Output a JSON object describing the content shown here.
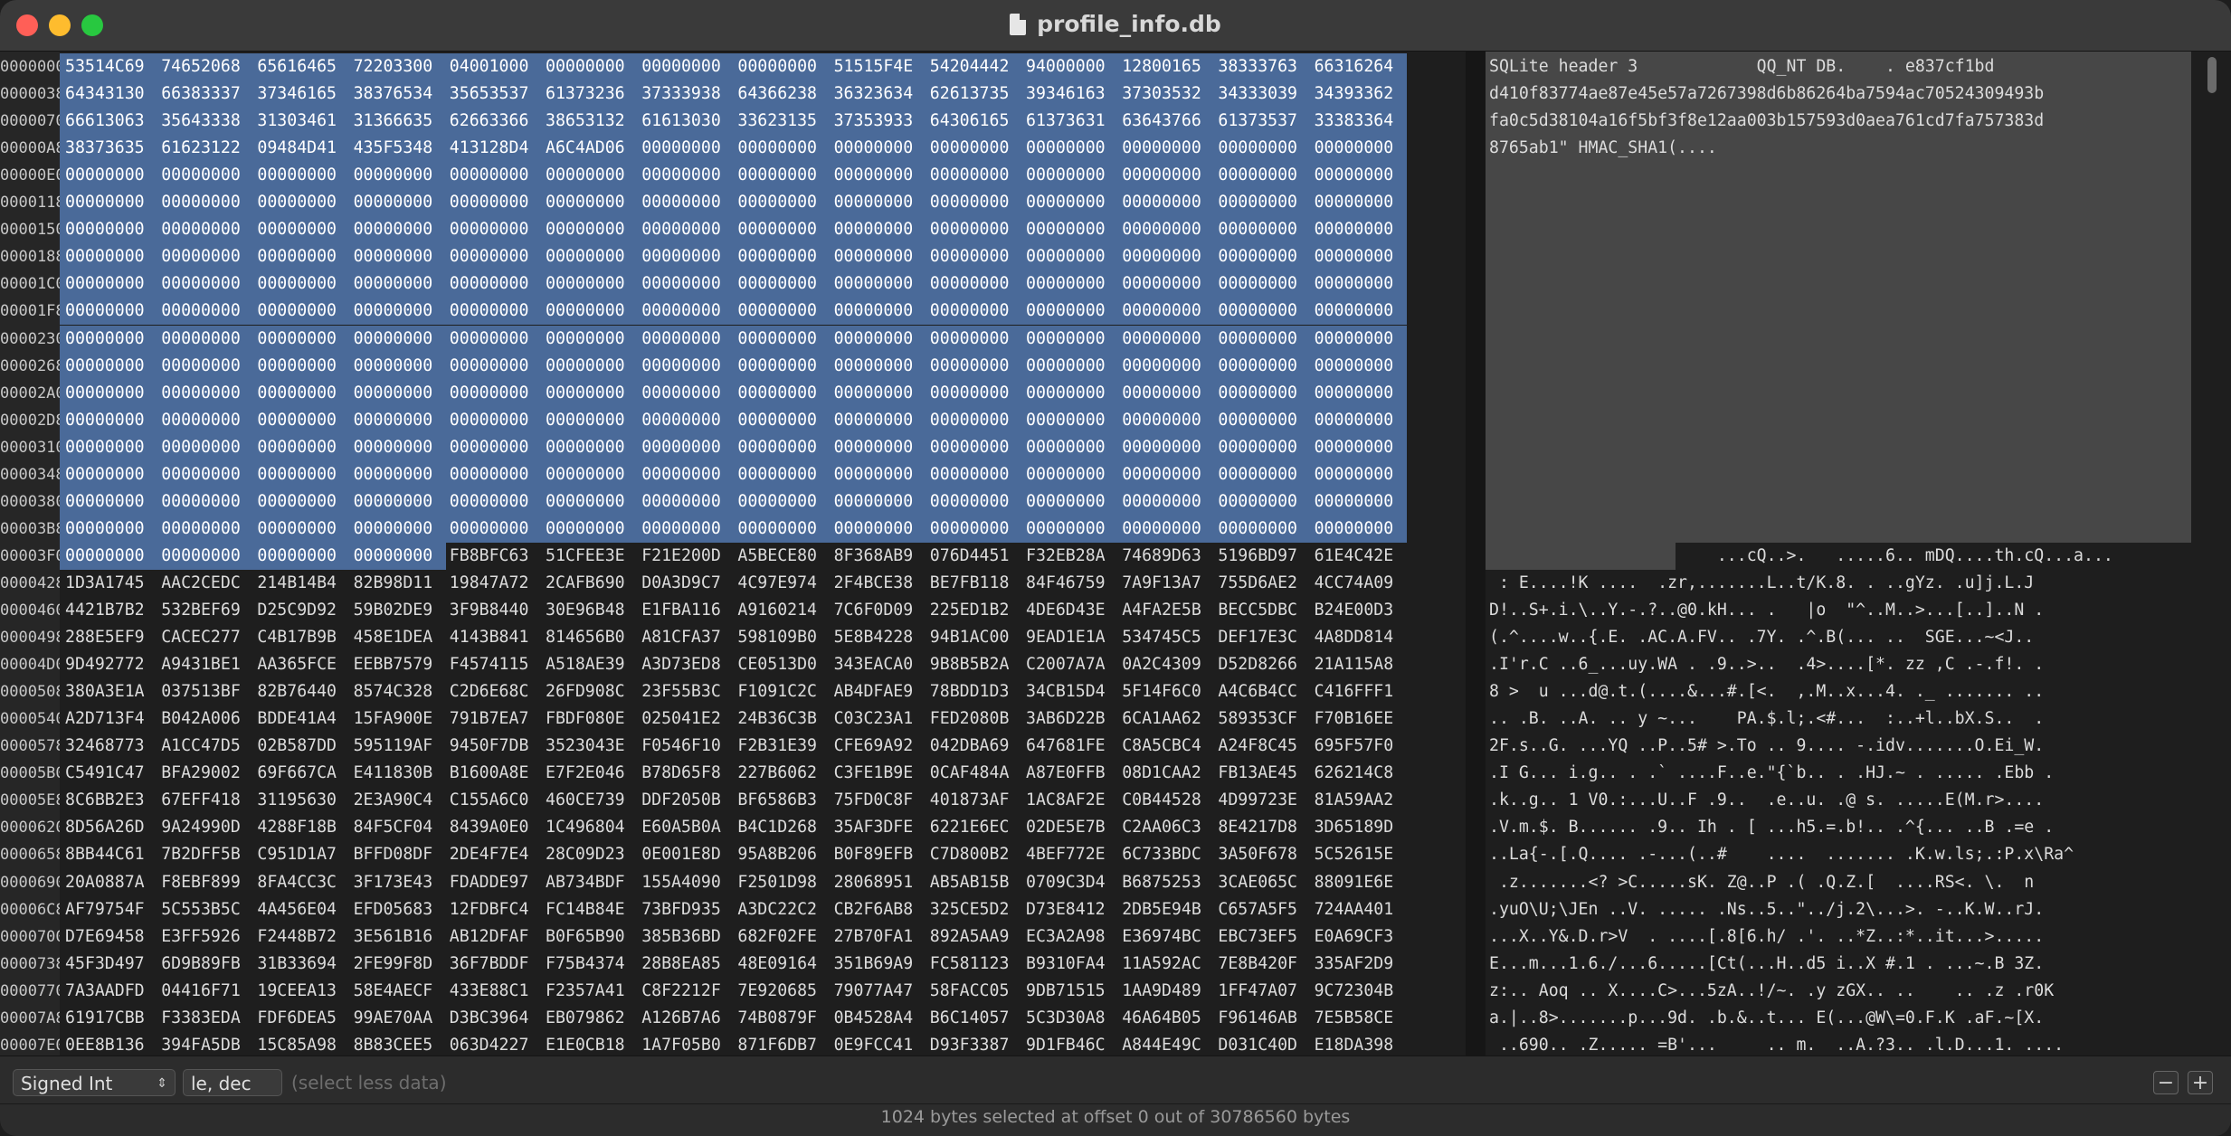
{
  "window": {
    "title": "profile_info.db"
  },
  "addresses": [
    "0000000",
    "0000038",
    "0000070",
    "00000A8",
    "00000E0",
    "0000118",
    "0000150",
    "0000188",
    "00001C0",
    "00001F8",
    "0000230",
    "0000268",
    "00002A0",
    "00002D8",
    "0000310",
    "0000348",
    "0000380",
    "00003B8",
    "00003F0",
    "0000428",
    "0000460",
    "0000498",
    "00004D0",
    "0000508",
    "0000540",
    "0000578",
    "00005B0",
    "00005E8",
    "0000620",
    "0000658",
    "0000690",
    "00006C8",
    "0000700",
    "0000738",
    "0000770",
    "00007A8",
    "00007E0"
  ],
  "hex_rows": [
    [
      "53514C69",
      "74652068",
      "65616465",
      "72203300",
      "04001000",
      "00000000",
      "00000000",
      "00000000",
      "51515F4E",
      "54204442",
      "94000000",
      "12800165",
      "38333763",
      "66316264"
    ],
    [
      "64343130",
      "66383337",
      "37346165",
      "38376534",
      "35653537",
      "61373236",
      "37333938",
      "64366238",
      "36323634",
      "62613735",
      "39346163",
      "37303532",
      "34333039",
      "34393362"
    ],
    [
      "66613063",
      "35643338",
      "31303461",
      "31366635",
      "62663366",
      "38653132",
      "61613030",
      "33623135",
      "37353933",
      "64306165",
      "61373631",
      "63643766",
      "61373537",
      "33383364"
    ],
    [
      "38373635",
      "61623122",
      "09484D41",
      "435F5348",
      "413128D4",
      "A6C4AD06",
      "00000000",
      "00000000",
      "00000000",
      "00000000",
      "00000000",
      "00000000",
      "00000000",
      "00000000"
    ],
    [
      "00000000",
      "00000000",
      "00000000",
      "00000000",
      "00000000",
      "00000000",
      "00000000",
      "00000000",
      "00000000",
      "00000000",
      "00000000",
      "00000000",
      "00000000",
      "00000000"
    ],
    [
      "00000000",
      "00000000",
      "00000000",
      "00000000",
      "00000000",
      "00000000",
      "00000000",
      "00000000",
      "00000000",
      "00000000",
      "00000000",
      "00000000",
      "00000000",
      "00000000"
    ],
    [
      "00000000",
      "00000000",
      "00000000",
      "00000000",
      "00000000",
      "00000000",
      "00000000",
      "00000000",
      "00000000",
      "00000000",
      "00000000",
      "00000000",
      "00000000",
      "00000000"
    ],
    [
      "00000000",
      "00000000",
      "00000000",
      "00000000",
      "00000000",
      "00000000",
      "00000000",
      "00000000",
      "00000000",
      "00000000",
      "00000000",
      "00000000",
      "00000000",
      "00000000"
    ],
    [
      "00000000",
      "00000000",
      "00000000",
      "00000000",
      "00000000",
      "00000000",
      "00000000",
      "00000000",
      "00000000",
      "00000000",
      "00000000",
      "00000000",
      "00000000",
      "00000000"
    ],
    [
      "00000000",
      "00000000",
      "00000000",
      "00000000",
      "00000000",
      "00000000",
      "00000000",
      "00000000",
      "00000000",
      "00000000",
      "00000000",
      "00000000",
      "00000000",
      "00000000"
    ],
    [
      "00000000",
      "00000000",
      "00000000",
      "00000000",
      "00000000",
      "00000000",
      "00000000",
      "00000000",
      "00000000",
      "00000000",
      "00000000",
      "00000000",
      "00000000",
      "00000000"
    ],
    [
      "00000000",
      "00000000",
      "00000000",
      "00000000",
      "00000000",
      "00000000",
      "00000000",
      "00000000",
      "00000000",
      "00000000",
      "00000000",
      "00000000",
      "00000000",
      "00000000"
    ],
    [
      "00000000",
      "00000000",
      "00000000",
      "00000000",
      "00000000",
      "00000000",
      "00000000",
      "00000000",
      "00000000",
      "00000000",
      "00000000",
      "00000000",
      "00000000",
      "00000000"
    ],
    [
      "00000000",
      "00000000",
      "00000000",
      "00000000",
      "00000000",
      "00000000",
      "00000000",
      "00000000",
      "00000000",
      "00000000",
      "00000000",
      "00000000",
      "00000000",
      "00000000"
    ],
    [
      "00000000",
      "00000000",
      "00000000",
      "00000000",
      "00000000",
      "00000000",
      "00000000",
      "00000000",
      "00000000",
      "00000000",
      "00000000",
      "00000000",
      "00000000",
      "00000000"
    ],
    [
      "00000000",
      "00000000",
      "00000000",
      "00000000",
      "00000000",
      "00000000",
      "00000000",
      "00000000",
      "00000000",
      "00000000",
      "00000000",
      "00000000",
      "00000000",
      "00000000"
    ],
    [
      "00000000",
      "00000000",
      "00000000",
      "00000000",
      "00000000",
      "00000000",
      "00000000",
      "00000000",
      "00000000",
      "00000000",
      "00000000",
      "00000000",
      "00000000",
      "00000000"
    ],
    [
      "00000000",
      "00000000",
      "00000000",
      "00000000",
      "00000000",
      "00000000",
      "00000000",
      "00000000",
      "00000000",
      "00000000",
      "00000000",
      "00000000",
      "00000000",
      "00000000"
    ],
    [
      "00000000",
      "00000000",
      "00000000",
      "00000000",
      "FB8BFC63",
      "51CFEE3E",
      "F21E200D",
      "A5BECE80",
      "8F368AB9",
      "076D4451",
      "F32EB28A",
      "74689D63",
      "5196BD97",
      "61E4C42E"
    ],
    [
      "1D3A1745",
      "AAC2CEDC",
      "214B14B4",
      "82B98D11",
      "19847A72",
      "2CAFB690",
      "D0A3D9C7",
      "4C97E974",
      "2F4BCE38",
      "BE7FB118",
      "84F46759",
      "7A9F13A7",
      "755D6AE2",
      "4CC74A09"
    ],
    [
      "4421B7B2",
      "532BEF69",
      "D25C9D92",
      "59B02DE9",
      "3F9B8440",
      "30E96B48",
      "E1FBA116",
      "A9160214",
      "7C6F0D09",
      "225ED1B2",
      "4DE6D43E",
      "A4FA2E5B",
      "BECC5DBC",
      "B24E00D3"
    ],
    [
      "288E5EF9",
      "CACEC277",
      "C4B17B9B",
      "458E1DEA",
      "4143B841",
      "814656B0",
      "A81CFA37",
      "598109B0",
      "5E8B4228",
      "94B1AC00",
      "9EAD1E1A",
      "534745C5",
      "DEF17E3C",
      "4A8DD814"
    ],
    [
      "9D492772",
      "A9431BE1",
      "AA365FCE",
      "EEBB7579",
      "F4574115",
      "A518AE39",
      "A3D73ED8",
      "CE0513D0",
      "343EACA0",
      "9B8B5B2A",
      "C2007A7A",
      "0A2C4309",
      "D52D8266",
      "21A115A8"
    ],
    [
      "380A3E1A",
      "037513BF",
      "82B76440",
      "8574C328",
      "C2D6E68C",
      "26FD908C",
      "23F55B3C",
      "F1091C2C",
      "AB4DFAE9",
      "78BDD1D3",
      "34CB15D4",
      "5F14F6C0",
      "A4C6B4CC",
      "C416FFF1"
    ],
    [
      "A2D713F4",
      "B042A006",
      "BDDE41A4",
      "15FA900E",
      "791B7EA7",
      "FBDF080E",
      "025041E2",
      "24B36C3B",
      "C03C23A1",
      "FED2080B",
      "3AB6D22B",
      "6CA1AA62",
      "589353CF",
      "F70B16EE"
    ],
    [
      "32468773",
      "A1CC47D5",
      "02B587DD",
      "595119AF",
      "9450F7DB",
      "3523043E",
      "F0546F10",
      "F2B31E39",
      "CFE69A92",
      "042DBA69",
      "647681FE",
      "C8A5CBC4",
      "A24F8C45",
      "695F57F0"
    ],
    [
      "C5491C47",
      "BFA29002",
      "69F667CA",
      "E411830B",
      "B1600A8E",
      "E7F2E046",
      "B78D65F8",
      "227B6062",
      "C3FE1B9E",
      "0CAF484A",
      "A87E0FFB",
      "08D1CAA2",
      "FB13AE45",
      "626214C8"
    ],
    [
      "8C6BB2E3",
      "67EFF418",
      "31195630",
      "2E3A90C4",
      "C155A6C0",
      "460CE739",
      "DDF2050B",
      "BF6586B3",
      "75FD0C8F",
      "401873AF",
      "1AC8AF2E",
      "C0B44528",
      "4D99723E",
      "81A59AA2"
    ],
    [
      "8D56A26D",
      "9A24990D",
      "4288F18B",
      "84F5CF04",
      "8439A0E0",
      "1C496804",
      "E60A5B0A",
      "B4C1D268",
      "35AF3DFE",
      "6221E6EC",
      "02DE5E7B",
      "C2AA06C3",
      "8E4217D8",
      "3D65189D"
    ],
    [
      "8BB44C61",
      "7B2DFF5B",
      "C951D1A7",
      "BFFD08DF",
      "2DE4F7E4",
      "28C09D23",
      "0E001E8D",
      "95A8B206",
      "B0F89EFB",
      "C7D800B2",
      "4BEF772E",
      "6C733BDC",
      "3A50F678",
      "5C52615E"
    ],
    [
      "20A0887A",
      "F8EBF899",
      "8FA4CC3C",
      "3F173E43",
      "FDADDE97",
      "AB734BDF",
      "155A4090",
      "F2501D98",
      "28068951",
      "AB5AB15B",
      "0709C3D4",
      "B6875253",
      "3CAE065C",
      "88091E6E"
    ],
    [
      "AF79754F",
      "5C553B5C",
      "4A456E04",
      "EFD05683",
      "12FDBFC4",
      "FC14B84E",
      "73BFD935",
      "A3DC22C2",
      "CB2F6AB8",
      "325CE5D2",
      "D73E8412",
      "2DB5E94B",
      "C657A5F5",
      "724AA401"
    ],
    [
      "D7E69458",
      "E3FF5926",
      "F2448B72",
      "3E561B16",
      "AB12DFAF",
      "B0F65B90",
      "385B36BD",
      "682F02FE",
      "27B70FA1",
      "892A5AA9",
      "EC3A2A98",
      "E36974BC",
      "EBC73EF5",
      "E0A69CF3"
    ],
    [
      "45F3D497",
      "6D9B89FB",
      "31B33694",
      "2FE99F8D",
      "36F7BDDF",
      "F75B4374",
      "28B8EA85",
      "48E09164",
      "351B69A9",
      "FC581123",
      "B9310FA4",
      "11A592AC",
      "7E8B420F",
      "335AF2D9"
    ],
    [
      "7A3AADFD",
      "04416F71",
      "19CEEA13",
      "58E4AECF",
      "433E88C1",
      "F2357A41",
      "C8F2212F",
      "7E920685",
      "79077A47",
      "58FACC05",
      "9DB71515",
      "1AA9D489",
      "1FF47A07",
      "9C72304B"
    ],
    [
      "61917CBB",
      "F3383EDA",
      "FDF6DEA5",
      "99AE70AA",
      "D3BC3964",
      "EB079862",
      "A126B7A6",
      "74B0879F",
      "0B4528A4",
      "B6C14057",
      "5C3D30A8",
      "46A64B05",
      "F96146AB",
      "7E5B58CE"
    ],
    [
      "0EE8B136",
      "394FA5DB",
      "15C85A98",
      "8B83CEE5",
      "063D4227",
      "E1E0CB18",
      "1A7F05B0",
      "871F6DB7",
      "0E9FCC41",
      "D93F3387",
      "9D1FB46C",
      "A844E49C",
      "D031C40D",
      "E18DA398"
    ]
  ],
  "ascii_rows": [
    "SQLite header 3            QQ_NT DB.    . e837cf1bd",
    "d410f83774ae87e45e57a7267398d6b86264ba7594ac70524309493b",
    "fa0c5d38104a16f5bf3f8e12aa003b157593d0aea761cd7fa757383d",
    "8765ab1\" HMAC_SHA1(....",
    "",
    "",
    "",
    "",
    "",
    "",
    "",
    "",
    "",
    "",
    "",
    "",
    "",
    "",
    "                       ...cQ..>.   .....6.. mDQ....th.cQ...a...",
    " : E....!K ....  .zr,.......L..t/K.8. . ..gYz. .u]j.L.J",
    "D!..S+.i.\\..Y.-.?..@0.kH... .   |o  \"^..M..>...[..]..N .",
    "(.^....w..{.E. .AC.A.FV.. .7Y. .^.B(... ..  SGE...~<J..",
    ".I'r.C ..6_...uy.WA . .9..>..  .4>....[*. zz ,C .-.f!. .",
    "8 >  u ...d@.t.(....&...#.[<.  ,.M..x...4. ._ ....... ..",
    ".. .B. ..A. .. y ~...    PA.$.l;.<#...  :..+l..bX.S..  .",
    "2F.s..G. ...YQ ..P..5# >.To .. 9.... -.idv.......O.Ei_W.",
    ".I G... i.g.. . .` ....F..e.\"{`b.. . .HJ.~ . ..... .Ebb .",
    ".k..g.. 1 V0.:...U..F .9..  .e..u. .@ s. .....E(M.r>....",
    ".V.m.$. B...... .9.. Ih . [ ...h5.=.b!.. .^{... ..B .=e .",
    "..La{-.[.Q.... .-...(..#    ....  ....... .K.w.ls;.:P.x\\Ra^",
    " .z.......<? >C.....sK. Z@..P .( .Q.Z.[  ....RS<. \\.  n",
    ".yuO\\U;\\JEn ..V. ..... .Ns..5..\"../j.2\\...>. -..K.W..rJ.",
    "...X..Y&.D.r>V  . ....[.8[6.h/ .'. ..*Z..:*..it...>.....",
    "E...m...1.6./...6.....[Ct(...H..d5 i..X #.1 . ...~.B 3Z.",
    "z:.. Aoq .. X....C>...5zA..!/~. .y zGX.. ..    .. .z .r0K",
    "a.|..8>.......p...9d. .b.&..t... E(...@W\\=0.F.K .aF.~[X.",
    " ..690.. .Z..... =B'...     .. m.  ..A.?3.. .l.D...1. ...."
  ],
  "selection": {
    "rows_full": 18,
    "last_row_words": 4
  },
  "toolbar": {
    "type_select": "Signed Int",
    "endian_select": "le, dec",
    "hint": "(select less data)",
    "minus_label": "−",
    "plus_label": "+"
  },
  "status": {
    "text": "1024 bytes selected at offset 0 out of 30786560 bytes"
  },
  "colors": {
    "selection": "#4a6a99",
    "background": "#1e1e1e",
    "titlebar": "#3a3a3a"
  }
}
